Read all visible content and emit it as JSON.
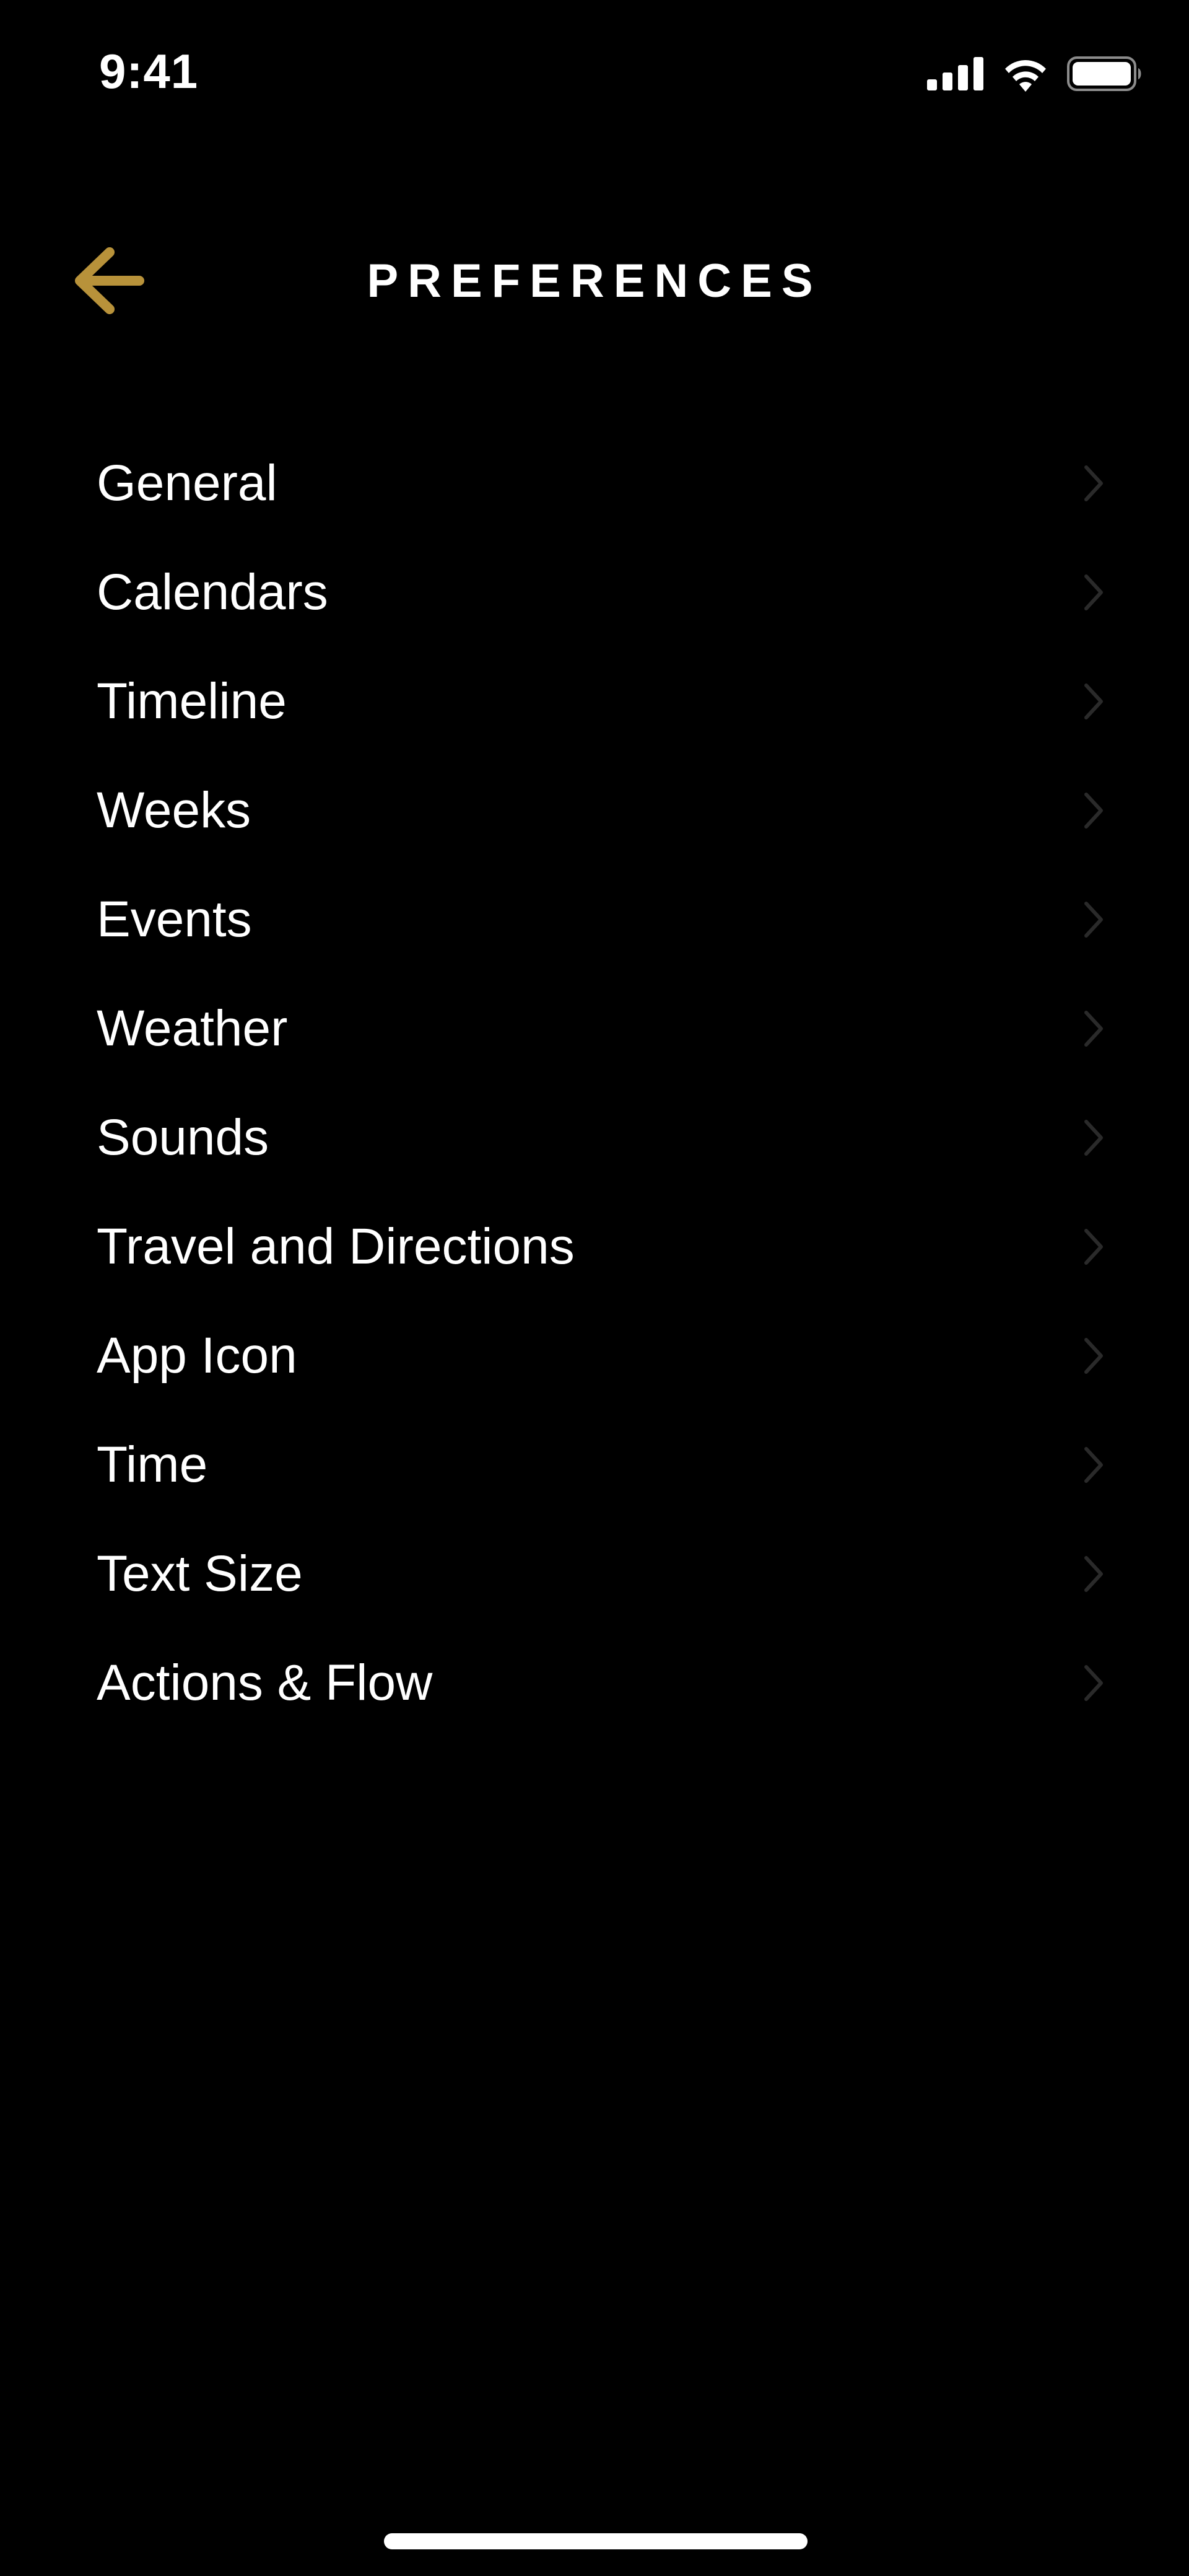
{
  "status_bar": {
    "time": "9:41",
    "icons": [
      "cellular-signal-icon",
      "wifi-icon",
      "battery-icon"
    ]
  },
  "nav": {
    "back_icon": "arrow-left-icon",
    "title": "PREFERENCES"
  },
  "menu": {
    "items": [
      {
        "label": "General"
      },
      {
        "label": "Calendars"
      },
      {
        "label": "Timeline"
      },
      {
        "label": "Weeks"
      },
      {
        "label": "Events"
      },
      {
        "label": "Weather"
      },
      {
        "label": "Sounds"
      },
      {
        "label": "Travel and Directions"
      },
      {
        "label": "App Icon"
      },
      {
        "label": "Time"
      },
      {
        "label": "Text Size"
      },
      {
        "label": "Actions & Flow"
      }
    ],
    "chevron_icon": "chevron-right-icon"
  },
  "colors": {
    "background": "#000000",
    "text": "#ffffff",
    "accent": "#b8923a",
    "chevron": "#2a2a2a"
  }
}
